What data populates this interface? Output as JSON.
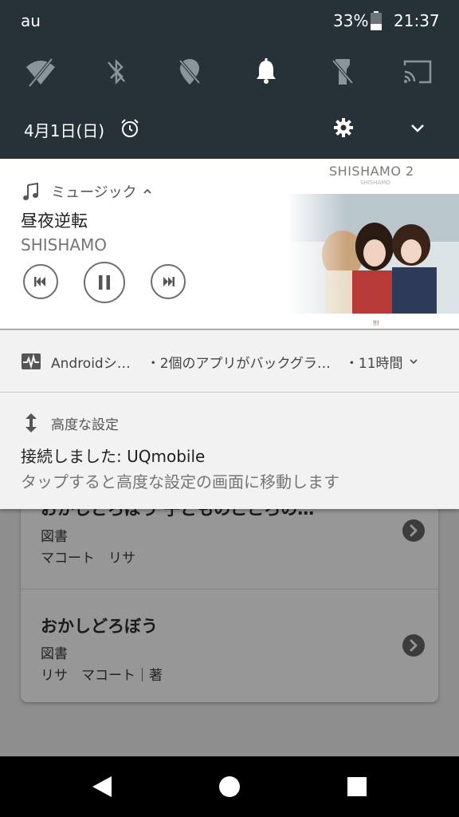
{
  "status_bar": {
    "carrier": "au",
    "battery_percent": "33%",
    "time": "21:37"
  },
  "quick_settings": {
    "tiles": [
      {
        "icon": "wifi-off-icon",
        "state": "off"
      },
      {
        "icon": "bluetooth-off-icon",
        "state": "off"
      },
      {
        "icon": "location-off-icon",
        "state": "off"
      },
      {
        "icon": "bell-icon",
        "state": "on"
      },
      {
        "icon": "flashlight-off-icon",
        "state": "off"
      },
      {
        "icon": "cast-icon",
        "state": "off"
      }
    ],
    "date": "4月1日(日)"
  },
  "music_notification": {
    "app_name": "ミュージック",
    "track_title": "昼夜逆転",
    "artist": "SHISHAMO",
    "album_title": "SHISHAMO 2",
    "album_subtitle": "SHISHAMO",
    "album_mark": "!!!"
  },
  "android_notification": {
    "app_name": "Androidシ…",
    "text": "・2個のアプリがバックグラ…",
    "time": "・11時間"
  },
  "advanced_notification": {
    "app_name": "高度な設定",
    "title": "接続しました: UQmobile",
    "text": "タップすると高度な設定の画面に移動します"
  },
  "background_list": {
    "items": [
      {
        "title": "おかしどろぼう 子どものこころの…",
        "category": "図書",
        "authors": "マコート　リサ"
      },
      {
        "title": "おかしどろぼう",
        "category": "図書",
        "authors": "リサ　マコート｜著"
      }
    ]
  },
  "colors": {
    "shade": "#263238",
    "notification_bg": "#f2f2f2",
    "music_bg": "#ffffff",
    "nav_bar": "#000000"
  }
}
